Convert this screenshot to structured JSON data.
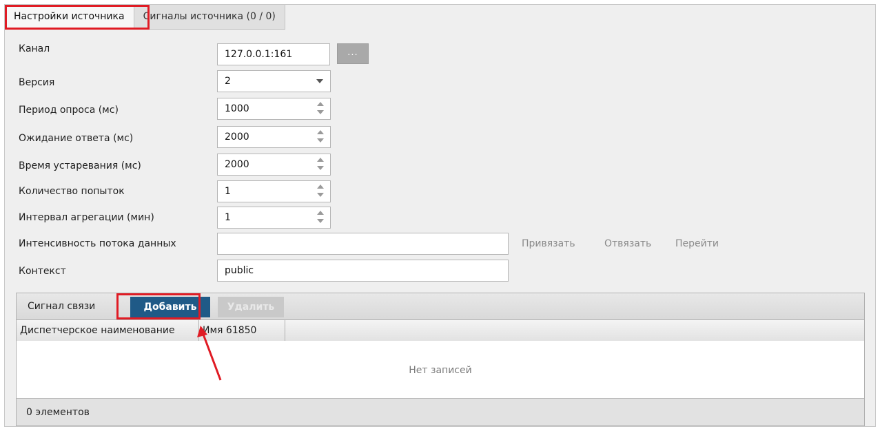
{
  "tabs": [
    {
      "label": "Настройки источника",
      "active": true
    },
    {
      "label": "Сигналы источника (0 / 0)",
      "active": false
    }
  ],
  "form": {
    "channel": {
      "label": "Канал",
      "value": "127.0.0.1:161",
      "browse_label": "..."
    },
    "version": {
      "label": "Версия",
      "value": "2"
    },
    "poll_period": {
      "label": "Период опроса (мс)",
      "value": "1000"
    },
    "response_timeout": {
      "label": "Ожидание ответа (мс)",
      "value": "2000"
    },
    "obsolescence_time": {
      "label": "Время устаревания (мс)",
      "value": "2000"
    },
    "retry_count": {
      "label": "Количество попыток",
      "value": "1"
    },
    "aggregation_interval": {
      "label": "Интервал агрегации (мин)",
      "value": "1"
    },
    "data_flow_intensity": {
      "label": "Интенсивность потока данных",
      "value": ""
    },
    "context": {
      "label": "Контекст",
      "value": "public"
    }
  },
  "binding_actions": {
    "bind": "Привязать",
    "unbind": "Отвязать",
    "goto": "Перейти"
  },
  "signals": {
    "title": "Сигнал связи",
    "add_label": "Добавить",
    "delete_label": "Удалить",
    "columns": [
      "Диспетчерское наименование",
      "Имя 61850"
    ],
    "empty_text": "Нет записей",
    "count_text": "0 элементов"
  },
  "colors": {
    "highlight": "#e01b24",
    "add_button": "#1f5a87",
    "disabled_button": "#c9c9c9",
    "panel_background": "#efefef"
  }
}
